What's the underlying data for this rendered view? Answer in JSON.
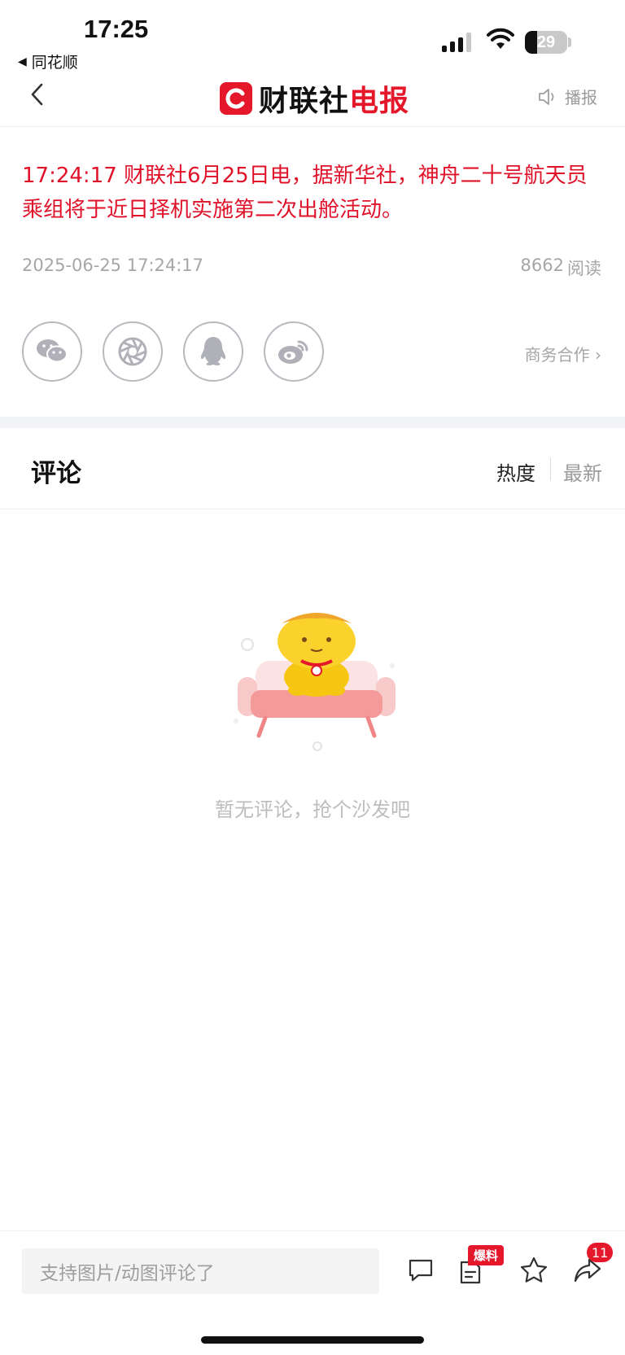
{
  "status_bar": {
    "time": "17:25",
    "back_app_label": "同花顺",
    "battery_level": "29"
  },
  "nav": {
    "logo_main": "财联社",
    "logo_accent": "电报",
    "broadcast_label": "播报"
  },
  "article": {
    "headline": "17:24:17 财联社6月25日电，据新华社，神舟二十号航天员乘组将于近日择机实施第二次出舱活动。",
    "datetime": "2025-06-25 17:24:17",
    "read_count": "8662",
    "read_label": "阅读",
    "business_link": "商务合作 ›"
  },
  "share": {
    "icons": [
      "wechat-icon",
      "moments-icon",
      "qq-icon",
      "weibo-icon"
    ]
  },
  "comments": {
    "title": "评论",
    "sort_hot": "热度",
    "sort_new": "最新",
    "empty_text": "暂无评论，抢个沙发吧"
  },
  "bottom_bar": {
    "input_placeholder": "支持图片/动图评论了",
    "tip_badge": "爆料",
    "share_count": "11"
  },
  "colors": {
    "accent": "#e4172b",
    "headline": "#e0122a",
    "muted": "#a6a6a6"
  }
}
